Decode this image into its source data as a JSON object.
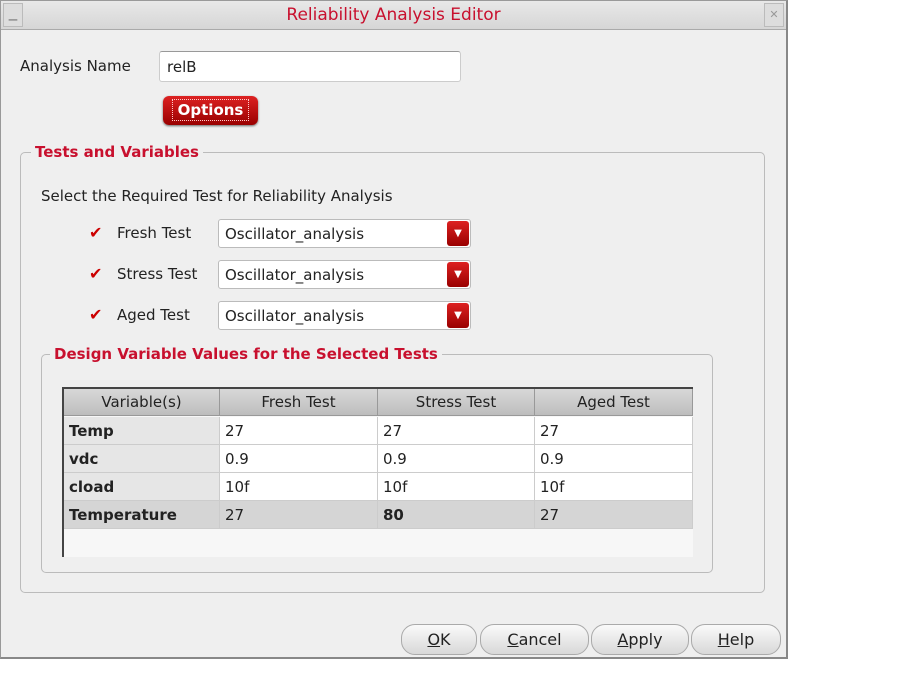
{
  "window": {
    "title": "Reliability Analysis Editor"
  },
  "analysis_name": {
    "label": "Analysis Name",
    "value": "relB"
  },
  "options_label": "Options",
  "tests_group": {
    "title": "Tests and Variables",
    "prompt": "Select the Required Test for Reliability Analysis",
    "tests": [
      {
        "label": "Fresh Test",
        "checked": true,
        "value": "Oscillator_analysis"
      },
      {
        "label": "Stress Test",
        "checked": true,
        "value": "Oscillator_analysis"
      },
      {
        "label": "Aged Test",
        "checked": true,
        "value": "Oscillator_analysis"
      }
    ]
  },
  "design_group": {
    "title": "Design Variable Values for the Selected Tests",
    "columns": [
      "Variable(s)",
      "Fresh Test",
      "Stress Test",
      "Aged Test"
    ],
    "rows": [
      [
        "Temp",
        "27",
        "27",
        "27"
      ],
      [
        "vdc",
        "0.9",
        "0.9",
        "0.9"
      ],
      [
        "cload",
        "10f",
        "10f",
        "10f"
      ],
      [
        "Temperature",
        "27",
        "80",
        "27"
      ]
    ]
  },
  "buttons": {
    "ok": {
      "mn": "O",
      "rest": "K"
    },
    "cancel": {
      "mn": "C",
      "rest": "ancel"
    },
    "apply": {
      "mn": "A",
      "rest": "pply"
    },
    "help": {
      "mn": "H",
      "rest": "elp"
    }
  }
}
